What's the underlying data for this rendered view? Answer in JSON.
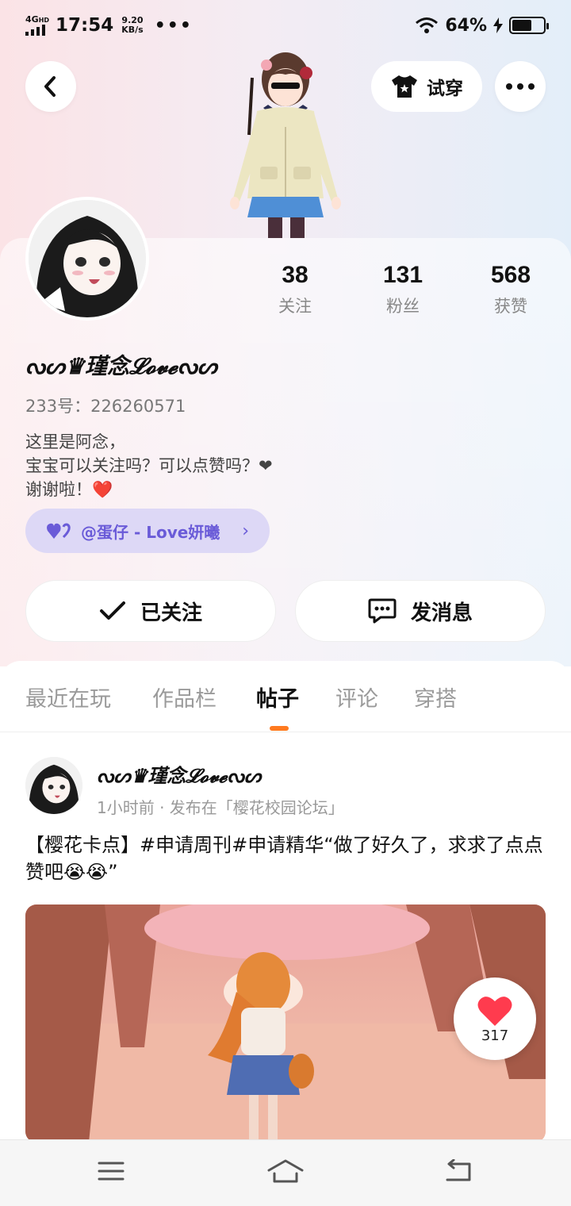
{
  "status_bar": {
    "network": "4G",
    "network_sub": "HD",
    "time": "17:54",
    "speed_value": "9.20",
    "speed_unit": "KB/s",
    "more": "•••",
    "battery": "64%",
    "battery_level": 0.64
  },
  "header": {
    "tryon_label": "试穿"
  },
  "profile": {
    "stats": [
      {
        "value": "38",
        "label": "关注"
      },
      {
        "value": "131",
        "label": "粉丝"
      },
      {
        "value": "568",
        "label": "获赞"
      }
    ],
    "username": "ᔓᔕ♛瑾念𝓛𝓸𝓿𝓮ᔓᔕ",
    "uid": "233号：226260571",
    "bio_lines": [
      "这里是阿念，",
      "宝宝可以关注吗？可以点赞吗？❤",
      "谢谢啦！"
    ],
    "bio_heart": "❤️",
    "cp_tag": "@蛋仔 - Love妍曦"
  },
  "actions": {
    "follow_label": "已关注",
    "message_label": "发消息"
  },
  "tabs": [
    {
      "label": "最近在玩",
      "active": false
    },
    {
      "label": "作品栏",
      "active": false
    },
    {
      "label": "帖子",
      "active": true
    },
    {
      "label": "评论",
      "active": false
    },
    {
      "label": "穿搭",
      "active": false
    }
  ],
  "post": {
    "author": "ᔓᔕ♛瑾念𝓛𝓸𝓿𝓮ᔓᔕ",
    "meta": "1小时前 · 发布在「樱花校园论坛」",
    "text": "【樱花卡点】#申请周刊#申请精华“做了好久了，求求了点点赞吧😭😭”",
    "likes": "317"
  },
  "colors": {
    "accent": "#ff7a1f",
    "cp_tag_bg": "#ddd8f6",
    "cp_tag_text": "#6a5bd8",
    "like_red": "#ff3b4e"
  }
}
